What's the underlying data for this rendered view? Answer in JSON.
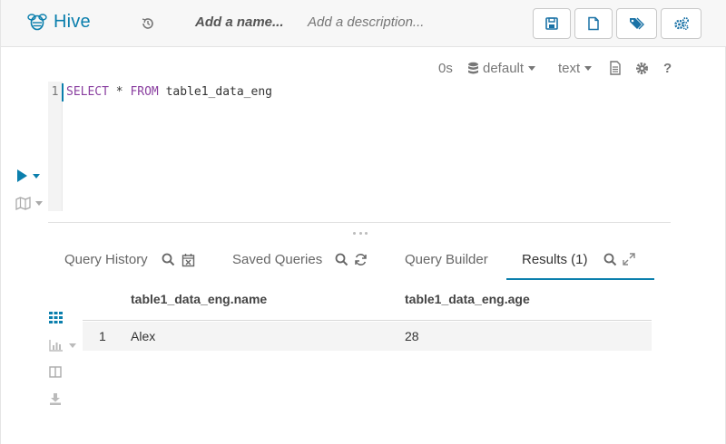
{
  "app": {
    "title": "Hive"
  },
  "header": {
    "name_placeholder": "Add a name...",
    "description_placeholder": "Add a description..."
  },
  "editor_toolbar": {
    "execution_time": "0s",
    "database": "default",
    "format": "text",
    "help": "?"
  },
  "editor": {
    "line_number": "1",
    "kw_select": "SELECT",
    "star": " * ",
    "kw_from": "FROM",
    "table": " table1_data_eng"
  },
  "tabs": [
    {
      "label": "Query History"
    },
    {
      "label": "Saved Queries"
    },
    {
      "label": "Query Builder"
    },
    {
      "label": "Results (1)"
    }
  ],
  "results": {
    "columns": [
      "table1_data_eng.name",
      "table1_data_eng.age"
    ],
    "rows": [
      {
        "index": "1",
        "name": "Alex",
        "age": "28"
      }
    ]
  },
  "colors": {
    "accent": "#0b7fad",
    "keyword": "#8a3fa0"
  }
}
